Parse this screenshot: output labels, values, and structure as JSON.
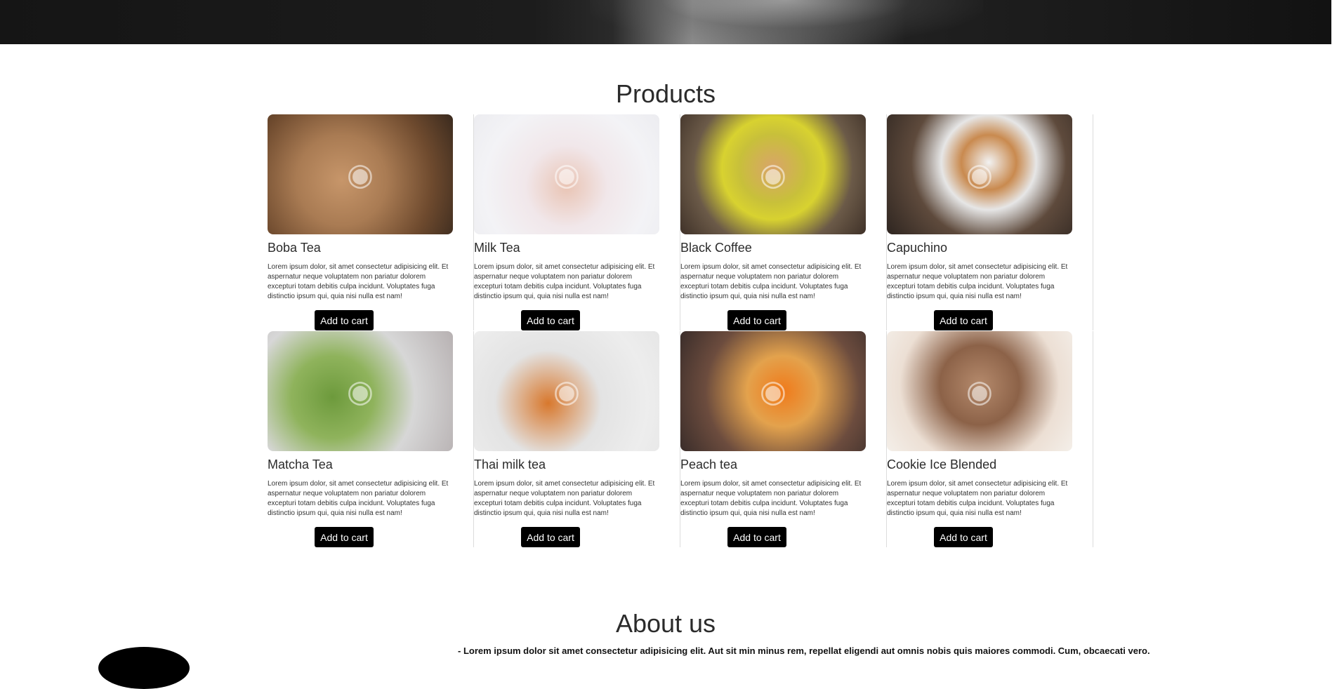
{
  "products": {
    "title": "Products",
    "items": [
      {
        "name": "Boba Tea",
        "description": "Lorem ipsum dolor, sit amet consectetur adipisicing elit. Et aspernatur neque voluptatem non pariatur dolorem excepturi totam debitis culpa incidunt. Voluptates fuga distinctio ipsum qui, quia nisi nulla est nam!",
        "button": "Add to cart",
        "image": "boba-tea-photo"
      },
      {
        "name": "Milk Tea",
        "description": "Lorem ipsum dolor, sit amet consectetur adipisicing elit. Et aspernatur neque voluptatem non pariatur dolorem excepturi totam debitis culpa incidunt. Voluptates fuga distinctio ipsum qui, quia nisi nulla est nam!",
        "button": "Add to cart",
        "image": "milk-tea-photo"
      },
      {
        "name": "Black Coffee",
        "description": "Lorem ipsum dolor, sit amet consectetur adipisicing elit. Et aspernatur neque voluptatem non pariatur dolorem excepturi totam debitis culpa incidunt. Voluptates fuga distinctio ipsum qui, quia nisi nulla est nam!",
        "button": "Add to cart",
        "image": "black-coffee-photo"
      },
      {
        "name": "Capuchino",
        "description": "Lorem ipsum dolor, sit amet consectetur adipisicing elit. Et aspernatur neque voluptatem non pariatur dolorem excepturi totam debitis culpa incidunt. Voluptates fuga distinctio ipsum qui, quia nisi nulla est nam!",
        "button": "Add to cart",
        "image": "capuchino-photo"
      },
      {
        "name": "Matcha Tea",
        "description": "Lorem ipsum dolor, sit amet consectetur adipisicing elit. Et aspernatur neque voluptatem non pariatur dolorem excepturi totam debitis culpa incidunt. Voluptates fuga distinctio ipsum qui, quia nisi nulla est nam!",
        "button": "Add to cart",
        "image": "matcha-tea-photo"
      },
      {
        "name": "Thai milk tea",
        "description": "Lorem ipsum dolor, sit amet consectetur adipisicing elit. Et aspernatur neque voluptatem non pariatur dolorem excepturi totam debitis culpa incidunt. Voluptates fuga distinctio ipsum qui, quia nisi nulla est nam!",
        "button": "Add to cart",
        "image": "thai-milk-tea-photo"
      },
      {
        "name": "Peach tea",
        "description": "Lorem ipsum dolor, sit amet consectetur adipisicing elit. Et aspernatur neque voluptatem non pariatur dolorem excepturi totam debitis culpa incidunt. Voluptates fuga distinctio ipsum qui, quia nisi nulla est nam!",
        "button": "Add to cart",
        "image": "peach-tea-photo"
      },
      {
        "name": "Cookie Ice Blended",
        "description": "Lorem ipsum dolor, sit amet consectetur adipisicing elit. Et aspernatur neque voluptatem non pariatur dolorem excepturi totam debitis culpa incidunt. Voluptates fuga distinctio ipsum qui, quia nisi nulla est nam!",
        "button": "Add to cart",
        "image": "cookie-ice-blended-photo"
      }
    ]
  },
  "about": {
    "title": "About us",
    "text": "- Lorem ipsum dolor sit amet consectetur adipisicing elit. Aut sit min minus rem, repellat eligendi aut omnis nobis quis maiores commodi. Cum, obcaecati vero."
  },
  "colors": {
    "button_bg": "#000000",
    "button_text": "#ffffff",
    "title_text": "#2b2b2b"
  }
}
